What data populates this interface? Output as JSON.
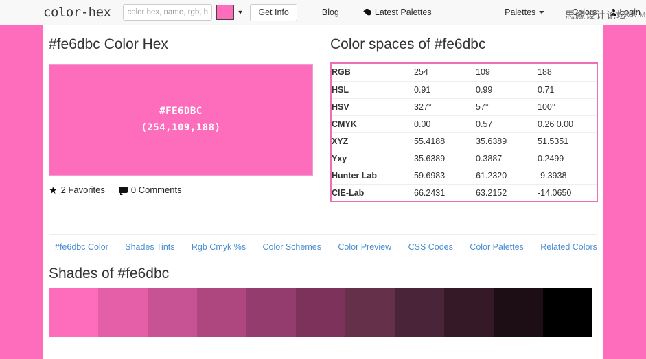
{
  "header": {
    "brand": "color-hex",
    "search": {
      "placeholder": "color hex, name, rgb, h:",
      "value": ""
    },
    "picker_color": "#fe6dbc",
    "get_info_label": "Get Info",
    "nav": {
      "blog": "Blog",
      "latest_palettes": "Latest Palettes",
      "palettes": "Palettes",
      "colors": "Colors",
      "login": "Login"
    }
  },
  "watermark": {
    "chinese": "思緣设计论坛",
    "url": "WWW.MISSYUAN.COM"
  },
  "main": {
    "page_title": "#fe6dbc Color Hex",
    "color_box": {
      "background": "#fe6dbc",
      "hex_label": "#FE6DBC",
      "rgb_label": "(254,109,188)"
    },
    "meta": {
      "favorites": "2 Favorites",
      "comments": "0 Comments"
    },
    "color_spaces": {
      "title": "Color spaces of #fe6dbc",
      "border_color": "#ee6fb4",
      "rows": [
        {
          "label": "RGB",
          "v1": "254",
          "v2": "109",
          "v3": "188"
        },
        {
          "label": "HSL",
          "v1": "0.91",
          "v2": "0.99",
          "v3": "0.71"
        },
        {
          "label": "HSV",
          "v1": "327°",
          "v2": "57°",
          "v3": "100°"
        },
        {
          "label": "CMYK",
          "v1": "0.00",
          "v2": "0.57",
          "v3": "0.26  0.00"
        },
        {
          "label": "XYZ",
          "v1": "55.4188",
          "v2": "35.6389",
          "v3": "51.5351"
        },
        {
          "label": "Yxy",
          "v1": "35.6389",
          "v2": "0.3887",
          "v3": "0.2499"
        },
        {
          "label": "Hunter Lab",
          "v1": "59.6983",
          "v2": "61.2320",
          "v3": "-9.3938"
        },
        {
          "label": "CIE-Lab",
          "v1": "66.2431",
          "v2": "63.2152",
          "v3": "-14.0650"
        }
      ]
    },
    "subnav": [
      {
        "label": "#fe6dbc Color"
      },
      {
        "label": "Shades Tints"
      },
      {
        "label": "Rgb Cmyk %s"
      },
      {
        "label": "Color Schemes"
      },
      {
        "label": "Color Preview"
      },
      {
        "label": "CSS Codes"
      },
      {
        "label": "Color Palettes"
      },
      {
        "label": "Related Colors"
      }
    ],
    "shades": {
      "title": "Shades of #fe6dbc",
      "colors": [
        "#fe6dbc",
        "#e45fa8",
        "#c85394",
        "#ae4780",
        "#953c6e",
        "#7d325c",
        "#653049",
        "#4a2438",
        "#361927",
        "#1d0d15",
        "#000000"
      ]
    }
  },
  "page_background": "#fe6dbc"
}
